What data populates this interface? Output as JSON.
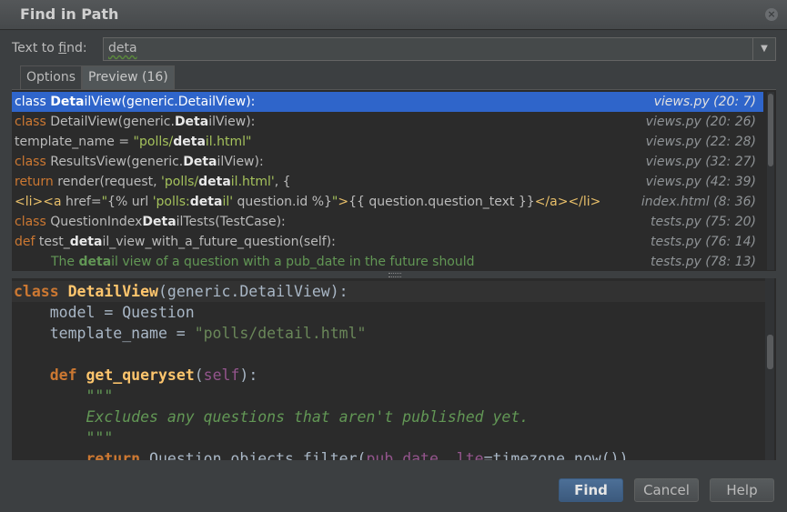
{
  "window": {
    "title": "Find in Path"
  },
  "find": {
    "label_pre": "Text to ",
    "label_mnemonic": "f",
    "label_post": "ind:",
    "value": "deta"
  },
  "tabs": [
    {
      "label": "Options"
    },
    {
      "label": "Preview (16)"
    }
  ],
  "results": [
    {
      "selected": true,
      "segments": [
        [
          "plain",
          "class "
        ],
        [
          "hl",
          "Deta"
        ],
        [
          "plain",
          "ilView(generic.DetailView):"
        ]
      ],
      "location": "views.py (20: 7)"
    },
    {
      "segments": [
        [
          "kw",
          "class "
        ],
        [
          "plain",
          "DetailView(generic."
        ],
        [
          "hl",
          "Deta"
        ],
        [
          "plain",
          "ilView):"
        ]
      ],
      "location": "views.py (20: 26)"
    },
    {
      "segments": [
        [
          "plain",
          "template_name = "
        ],
        [
          "str",
          "\"polls/"
        ],
        [
          "strhl",
          "deta"
        ],
        [
          "str",
          "il.html\""
        ]
      ],
      "location": "views.py (22: 28)"
    },
    {
      "segments": [
        [
          "kw",
          "class "
        ],
        [
          "plain",
          "ResultsView(generic."
        ],
        [
          "hl",
          "Deta"
        ],
        [
          "plain",
          "ilView):"
        ]
      ],
      "location": "views.py (32: 27)"
    },
    {
      "segments": [
        [
          "kw",
          "return "
        ],
        [
          "plain",
          "render(request, "
        ],
        [
          "str",
          "'polls/"
        ],
        [
          "strhl",
          "deta"
        ],
        [
          "str",
          "il.html'"
        ],
        [
          "plain",
          ", {"
        ]
      ],
      "location": "views.py (42: 39)"
    },
    {
      "segments": [
        [
          "tag",
          "<li><a "
        ],
        [
          "plain",
          "href="
        ],
        [
          "str",
          "\""
        ],
        [
          "plain",
          "{% url "
        ],
        [
          "str",
          "'polls:"
        ],
        [
          "strhl",
          "deta"
        ],
        [
          "str",
          "il'"
        ],
        [
          "plain",
          " question.id %}"
        ],
        [
          "str",
          "\""
        ],
        [
          "tag",
          ">"
        ],
        [
          "plain",
          "{{ question.question_text }}"
        ],
        [
          "tag",
          "</a></li>"
        ]
      ],
      "location": "index.html (8: 36)"
    },
    {
      "segments": [
        [
          "kw",
          "class "
        ],
        [
          "plain",
          "QuestionIndex"
        ],
        [
          "hl",
          "Deta"
        ],
        [
          "plain",
          "ilTests(TestCase):"
        ]
      ],
      "location": "tests.py (75: 20)"
    },
    {
      "segments": [
        [
          "kw",
          "def "
        ],
        [
          "plain",
          "test_"
        ],
        [
          "hl",
          "deta"
        ],
        [
          "plain",
          "il_view_with_a_future_question(self):"
        ]
      ],
      "location": "tests.py (76: 14)"
    },
    {
      "indent": true,
      "segments": [
        [
          "doc",
          "The "
        ],
        [
          "dochl",
          "deta"
        ],
        [
          "doc",
          "il view of a question with a pub_date in the future should"
        ]
      ],
      "location": "tests.py (78: 13)"
    }
  ],
  "preview_lines": [
    {
      "caret": true,
      "segments": [
        [
          "kw",
          "class "
        ],
        [
          "fn",
          "DetailView"
        ],
        [
          "plain",
          "(generic.DetailView):"
        ]
      ]
    },
    {
      "segments": [
        [
          "plain",
          "    model = Question"
        ]
      ]
    },
    {
      "segments": [
        [
          "plain",
          "    template_name = "
        ],
        [
          "str",
          "\"polls/detail.html\""
        ]
      ]
    },
    {
      "segments": [
        [
          "plain",
          ""
        ]
      ]
    },
    {
      "segments": [
        [
          "plain",
          "    "
        ],
        [
          "kw",
          "def "
        ],
        [
          "fn",
          "get_queryset"
        ],
        [
          "plain",
          "("
        ],
        [
          "self",
          "self"
        ],
        [
          "plain",
          "):"
        ]
      ]
    },
    {
      "segments": [
        [
          "doc",
          "        \"\"\""
        ]
      ]
    },
    {
      "segments": [
        [
          "doc",
          "        Excludes any questions that aren't published yet."
        ]
      ]
    },
    {
      "segments": [
        [
          "doc",
          "        \"\"\""
        ]
      ]
    },
    {
      "segments": [
        [
          "plain",
          "        "
        ],
        [
          "kw",
          "return "
        ],
        [
          "plain",
          "Question.objects.filter("
        ],
        [
          "self",
          "pub_date__lte"
        ],
        [
          "plain",
          "=timezone.now())"
        ]
      ]
    }
  ],
  "buttons": {
    "find": "Find",
    "cancel": "Cancel",
    "help": "Help"
  },
  "colors": {
    "selection": "#2f65ca",
    "keyword": "#cc7832",
    "string": "#6a8759",
    "docstring": "#629755",
    "function": "#ffc66d"
  }
}
